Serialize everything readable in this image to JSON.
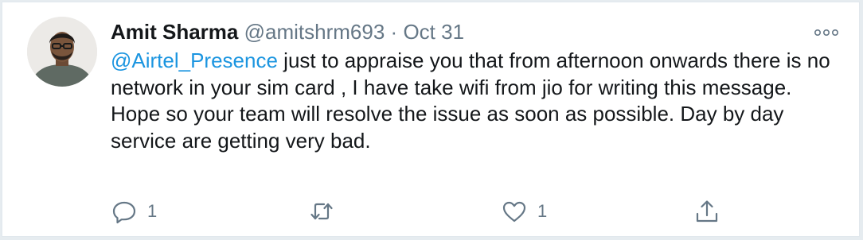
{
  "tweet": {
    "author_name": "Amit Sharma",
    "author_handle": "@amitshrm693",
    "separator": "·",
    "date": "Oct 31",
    "mention": "@Airtel_Presence",
    "text_line1_rest": " just to appraise you that from afternoon onwards there is no network in your sim card , I have take wifi from jio for writing this message.",
    "text_para2": "Hope so your team will resolve the issue as soon as possible. Day by day service are getting very bad."
  },
  "actions": {
    "reply_count": "1",
    "like_count": "1"
  },
  "icons": {
    "more": "more-dots-icon",
    "reply": "reply-icon",
    "retweet": "retweet-icon",
    "like": "heart-icon",
    "share": "share-icon"
  },
  "colors": {
    "mention": "#1b95e0",
    "secondary_text": "#657786",
    "icon": "#657786"
  }
}
